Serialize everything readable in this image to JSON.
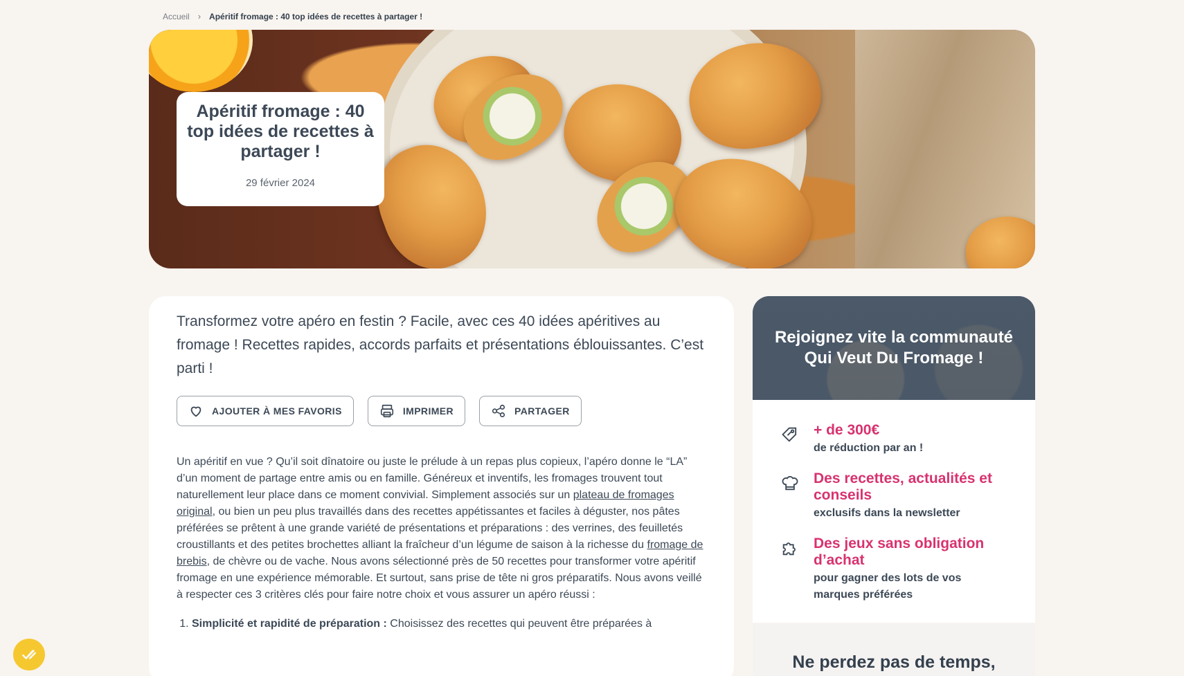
{
  "breadcrumb": {
    "home": "Accueil",
    "separator": "›",
    "current": "Apéritif fromage : 40 top idées de recettes à partager !"
  },
  "hero": {
    "title": "Apéritif fromage : 40 top idées de recettes à partager !",
    "date": "29 février 2024"
  },
  "article": {
    "intro": "Transformez votre apéro en festin ? Facile, avec ces 40 idées apéritives au fromage ! Recettes rapides, accords parfaits et présentations éblouissantes. C’est parti !",
    "actions": {
      "favorite": "AJOUTER À MES FAVORIS",
      "print": "IMPRIMER",
      "share": "PARTAGER"
    },
    "body_part1": "Un apéritif en vue ? Qu’il soit dînatoire ou juste le prélude à un repas plus copieux, l’apéro donne le “LA” d’un moment de partage entre amis ou en famille. Généreux et inventifs, les fromages trouvent tout naturellement leur place dans ce moment convivial. Simplement associés sur un ",
    "link1": "plateau de fromages original",
    "body_part2": ", ou bien un peu plus travaillés dans des recettes appétissantes et faciles à déguster, nos pâtes préférées se prêtent à une grande variété de présentations et préparations : des verrines, des feuilletés croustillants et des petites brochettes alliant la fraîcheur d’un légume de saison à la richesse du ",
    "link2": "fromage de brebis",
    "body_part3": ", de chèvre ou de vache. Nous avons sélectionné près de 50 recettes pour transformer votre apéritif fromage en une expérience mémorable. Et surtout, sans prise de tête ni gros préparatifs. Nous avons veillé à respecter ces 3 critères clés pour faire notre choix et vous assurer un apéro réussi :",
    "list_item1_bold": "Simplicité et rapidité de préparation :",
    "list_item1_text": " Choisissez des recettes qui peuvent être préparées à"
  },
  "sidebar": {
    "title": "Rejoignez vite la communauté Qui Veut Du Fromage !",
    "perks": [
      {
        "icon": "discount-tag-icon",
        "headline": "+ de 300€",
        "sub": "de réduction par an !"
      },
      {
        "icon": "chef-hat-icon",
        "headline": "Des recettes, actualités et conseils",
        "sub": "exclusifs dans la newsletter"
      },
      {
        "icon": "puzzle-icon",
        "headline": "Des jeux sans obligation d’achat",
        "sub": "pour gagner des lots de vos marques préférées"
      }
    ],
    "footer_title": "Ne perdez pas de temps, inscrivez-vous !"
  },
  "colors": {
    "accent_pink": "#d8326f",
    "text_dark": "#3c4856",
    "fab_yellow": "#f6c830"
  }
}
